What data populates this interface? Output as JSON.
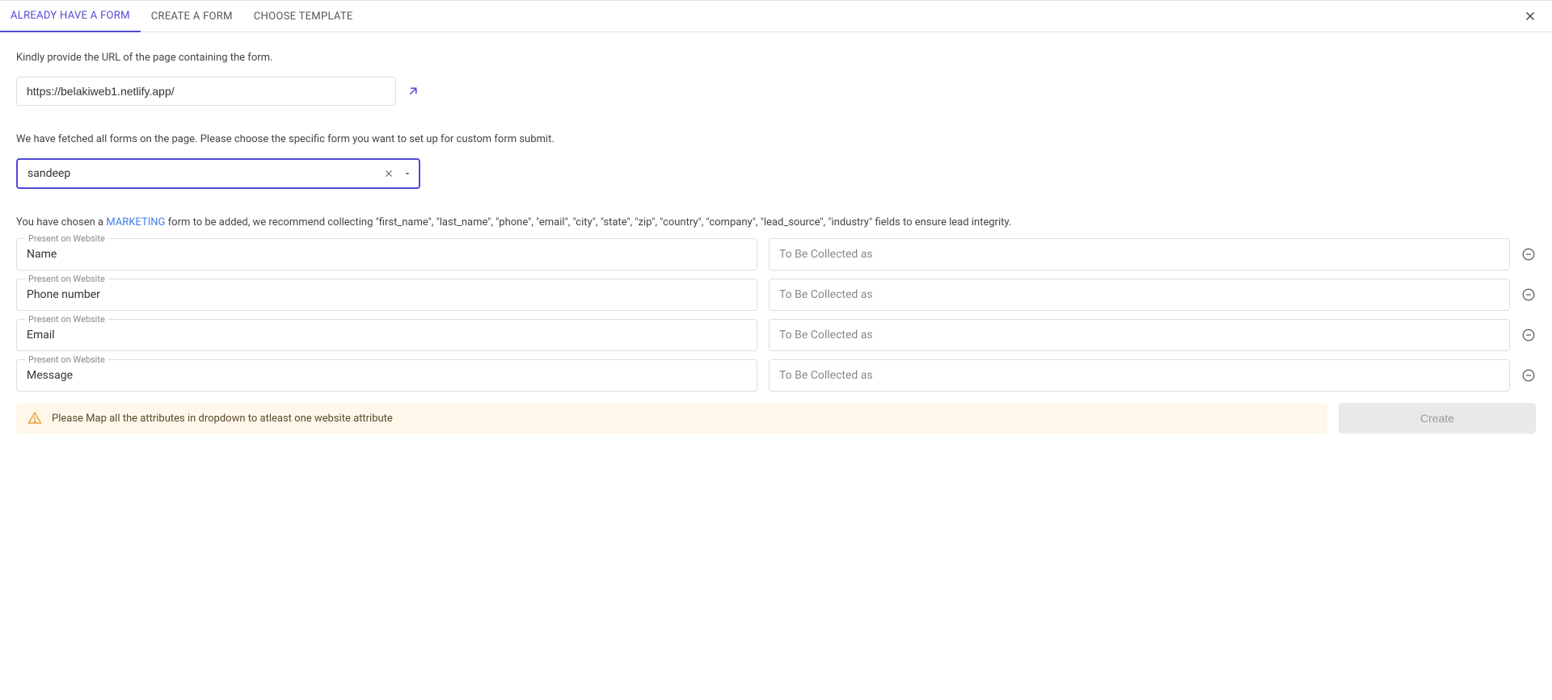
{
  "tabs": [
    {
      "label": "ALREADY HAVE A FORM",
      "active": true
    },
    {
      "label": "CREATE A FORM",
      "active": false
    },
    {
      "label": "CHOOSE TEMPLATE",
      "active": false
    }
  ],
  "url_instruction": "Kindly provide the URL of the page containing the form.",
  "url_value": "https://belakiweb1.netlify.app/",
  "fetched_instruction": "We have fetched all forms on the page. Please choose the specific form you want to set up for custom form submit.",
  "form_select_value": "sandeep",
  "chosen_prefix": "You have chosen a ",
  "chosen_link": "MARKETING",
  "chosen_suffix": " form to be added, we recommend collecting \"first_name\", \"last_name\", \"phone\", \"email\", \"city\", \"state\", \"zip\", \"country\", \"company\", \"lead_source\", \"industry\" fields to ensure lead integrity.",
  "present_label": "Present on Website",
  "collect_placeholder": "To Be Collected as",
  "rows": [
    {
      "present": "Name"
    },
    {
      "present": "Phone number"
    },
    {
      "present": "Email"
    },
    {
      "present": "Message"
    }
  ],
  "warning_text": "Please Map all the attributes in dropdown to atleast one website attribute",
  "create_label": "Create"
}
